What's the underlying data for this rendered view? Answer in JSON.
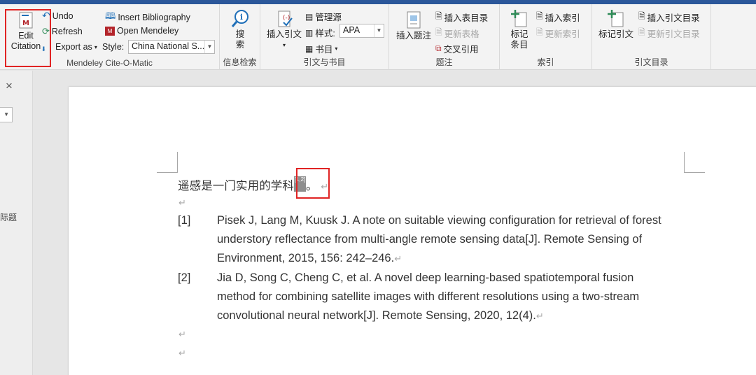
{
  "ribbon": {
    "mendeley": {
      "edit_citation_line1": "Edit",
      "edit_citation_line2": "Citation",
      "undo": "Undo",
      "refresh": "Refresh",
      "export_as": "Export as",
      "insert_bibliography": "Insert Bibliography",
      "open_mendeley": "Open Mendeley",
      "style_label": "Style:",
      "style_value": "China National S...",
      "group_label": "Mendeley Cite-O-Matic"
    },
    "search": {
      "line1": "搜",
      "line2": "索",
      "group_label": "信息检索"
    },
    "citations": {
      "insert_citation": "插入引文",
      "manage_sources": "管理源",
      "style_label": "样式:",
      "style_value": "APA",
      "bibliography": "书目",
      "group_label": "引文与书目"
    },
    "captions": {
      "insert_caption": "插入题注",
      "insert_table_of_figures": "插入表目录",
      "update_table": "更新表格",
      "cross_reference": "交叉引用",
      "group_label": "题注"
    },
    "index": {
      "mark_entry_line1": "标记",
      "mark_entry_line2": "条目",
      "insert_index": "插入索引",
      "update_index": "更新索引",
      "group_label": "索引"
    },
    "toa": {
      "mark_citation": "标记引文",
      "insert_toa": "插入引文目录",
      "update_toa": "更新引文目录",
      "group_label": "引文目录"
    }
  },
  "leftpane": {
    "close": "×",
    "heading_fragment": "际题"
  },
  "document": {
    "sentence": "遥感是一门实用的学科",
    "citation_marker": "[1,2]",
    "sentence_end": "。",
    "references": [
      {
        "num": "[1]",
        "lines": [
          "Pisek J, Lang M, Kuusk J. A note on suitable viewing configuration for retrieval of forest",
          "understory reflectance from multi-angle remote sensing data[J]. Remote Sensing of",
          "Environment, 2015, 156: 242–246."
        ]
      },
      {
        "num": "[2]",
        "lines": [
          "Jia D, Song C, Cheng C, et al. A novel deep learning-based spatiotemporal fusion",
          "method for combining satellite images with different resolutions using a two-stream",
          "convolutional neural network[J]. Remote Sensing, 2020, 12(4)."
        ]
      }
    ]
  },
  "colors": {
    "accent": "#2b579a",
    "highlight_box": "#e02424",
    "mendeley_red": "#b3242a"
  }
}
